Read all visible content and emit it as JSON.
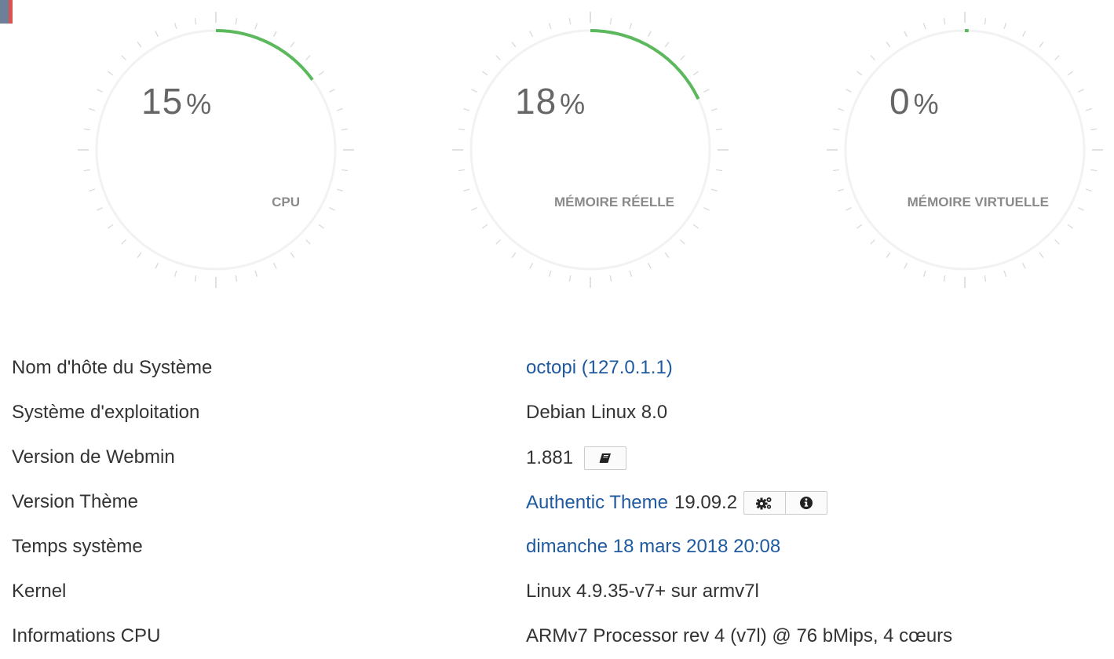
{
  "colors": {
    "accent_arc": "#5cb85c",
    "track": "#f2f2f2",
    "ticks": "#d9d9d9",
    "link": "#1f5aa0",
    "flag_left": "#6e7f99",
    "flag_right": "#d9534f"
  },
  "gauges": [
    {
      "value_text": "15",
      "unit": "%",
      "label": "CPU",
      "percent": 15
    },
    {
      "value_text": "18",
      "unit": "%",
      "label": "MÉMOIRE RÉELLE",
      "percent": 18
    },
    {
      "value_text": "0",
      "unit": "%",
      "label": "MÉMOIRE VIRTUELLE",
      "percent": 0
    }
  ],
  "info": {
    "hostname": {
      "label": "Nom d'hôte du Système",
      "value": "octopi (127.0.1.1)"
    },
    "os": {
      "label": "Système d'exploitation",
      "value": "Debian Linux 8.0"
    },
    "webmin": {
      "label": "Version de Webmin",
      "value": "1.881",
      "icon": "book-icon"
    },
    "theme": {
      "label": "Version Thème",
      "name": "Authentic Theme",
      "version": "19.09.2",
      "icons": [
        "cogs-icon",
        "info-icon"
      ]
    },
    "time": {
      "label": "Temps système",
      "value": "dimanche 18 mars 2018 20:08"
    },
    "kernel": {
      "label": "Kernel",
      "value": "Linux 4.9.35-v7+ sur armv7l"
    },
    "cpu_info": {
      "label": "Informations CPU",
      "value": "ARMv7 Processor rev 4 (v7l) @ 76 bMips, 4 cœurs"
    }
  }
}
